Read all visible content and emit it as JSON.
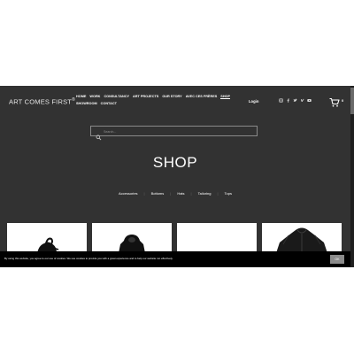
{
  "header": {
    "logo_text": "ART COMES FIRST",
    "logo_mark": "®",
    "nav_rows": [
      [
        "HOME",
        "WORK",
        "CONSULTANCY",
        "ART PROJECTS",
        "OUR STORY",
        "AVEC CES FRÈRES",
        "SHOP"
      ],
      [
        "SHOWROOM",
        "CONTACT"
      ]
    ],
    "active_nav": "SHOP",
    "login_label": "Login",
    "social_icons": [
      "instagram-icon",
      "facebook-icon",
      "twitter-icon",
      "vimeo-icon",
      "youtube-icon"
    ],
    "cart_count": "0"
  },
  "search": {
    "placeholder": "Search..."
  },
  "page": {
    "title": "SHOP",
    "categories": [
      "Accessories",
      "Bottoms",
      "Hats",
      "Tailoring",
      "Tops"
    ]
  },
  "products": [
    {
      "icon": "product-bag-image"
    },
    {
      "icon": "product-hoodie-image"
    },
    {
      "icon": "product-blank-image"
    },
    {
      "icon": "product-jacket-image"
    }
  ],
  "cookie": {
    "text": "By using this website, you agree to our use of cookies. We use cookies to provide you with a great experience and to help our website run effectively.",
    "ok_label": "OK"
  },
  "colors": {
    "background": "#323232",
    "cookie_bar": "#000000",
    "ok_button": "#8b8b8b",
    "text": "#ffffff"
  }
}
